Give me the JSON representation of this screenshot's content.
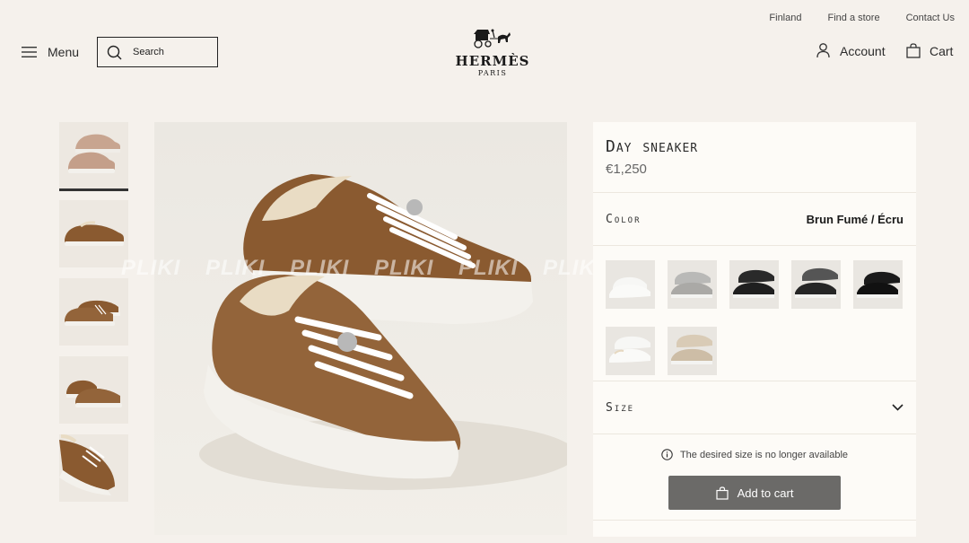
{
  "header": {
    "top_links": [
      "Finland",
      "Find a store",
      "Contact Us"
    ],
    "menu_label": "Menu",
    "search_placeholder": "Search",
    "logo_brand": "HERMÈS",
    "logo_city": "PARIS",
    "account_label": "Account",
    "cart_label": "Cart"
  },
  "gallery": {
    "thumbnails": [
      "thumb-1",
      "thumb-2",
      "thumb-3",
      "thumb-4",
      "thumb-5"
    ],
    "active_index": 0,
    "watermark": "PLIKI PLIKI PLIKI PLIKI PLIKI PLIKI PLIKI PLIKI PLIKI"
  },
  "product": {
    "title": "Day sneaker",
    "price": "€1,250",
    "color_label": "Color",
    "color_value": "Brun Fumé / Écru",
    "size_label": "Size",
    "availability": "The desired size is no longer available",
    "add_to_cart": "Add to cart"
  },
  "colors": {
    "suede": "#8a5a30",
    "suede_dark": "#6e4524",
    "fleece": "#e9dcc4",
    "sole": "#f3f1ec",
    "button": "#6b6a68"
  }
}
